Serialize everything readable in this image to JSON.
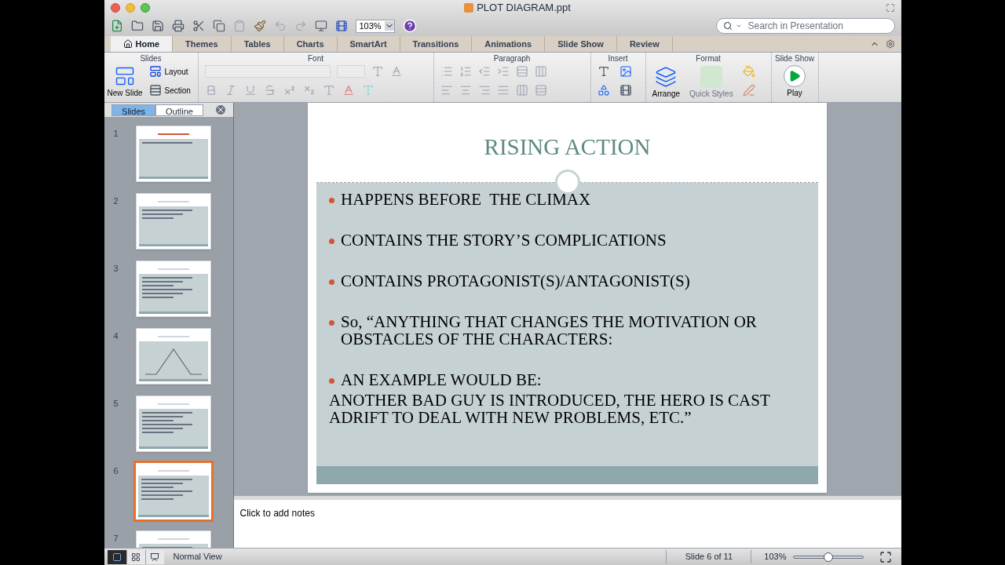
{
  "window": {
    "title": "PLOT DIAGRAM.ppt"
  },
  "toolbar": {
    "zoom": "103%"
  },
  "search": {
    "placeholder": "Search in Presentation"
  },
  "tabs": [
    {
      "label": "Home",
      "selected": true
    },
    {
      "label": "Themes",
      "selected": false
    },
    {
      "label": "Tables",
      "selected": false
    },
    {
      "label": "Charts",
      "selected": false
    },
    {
      "label": "SmartArt",
      "selected": false
    },
    {
      "label": "Transitions",
      "selected": false
    },
    {
      "label": "Animations",
      "selected": false
    },
    {
      "label": "Slide Show",
      "selected": false
    },
    {
      "label": "Review",
      "selected": false
    }
  ],
  "ribbon": {
    "slides_group": {
      "title": "Slides",
      "new_slide": "New Slide",
      "layout": "Layout",
      "section": "Section"
    },
    "font_group": {
      "title": "Font"
    },
    "paragraph_group": {
      "title": "Paragraph"
    },
    "insert_group": {
      "title": "Insert"
    },
    "format_group": {
      "title": "Format",
      "arrange": "Arrange",
      "quick_styles": "Quick Styles"
    },
    "slideshow_group": {
      "title": "Slide Show",
      "play": "Play"
    }
  },
  "pane_tabs": [
    {
      "label": "Slides",
      "selected": true
    },
    {
      "label": "Outline",
      "selected": false
    }
  ],
  "thumbnails": [
    {
      "number": "1",
      "selected": false,
      "kind": "title"
    },
    {
      "number": "2",
      "selected": false,
      "kind": "text"
    },
    {
      "number": "3",
      "selected": false,
      "kind": "list"
    },
    {
      "number": "4",
      "selected": false,
      "kind": "diagram"
    },
    {
      "number": "5",
      "selected": false,
      "kind": "list"
    },
    {
      "number": "6",
      "selected": true,
      "kind": "list"
    },
    {
      "number": "7",
      "selected": false,
      "kind": "text"
    }
  ],
  "slide": {
    "title": "RISING ACTION",
    "items": [
      {
        "kind": "bullet",
        "text": "HAPPENS BEFORE  THE CLIMAX"
      },
      {
        "kind": "bullet",
        "text": "CONTAINS THE STORY’S COMPLICATIONS"
      },
      {
        "kind": "bullet",
        "text": "CONTAINS PROTAGONIST(S)/ANTAGONIST(S)"
      },
      {
        "kind": "bullet",
        "text": "So, “ANYTHING THAT CHANGES THE MOTIVATION OR OBSTACLES OF THE CHARACTERS:"
      },
      {
        "kind": "bullet",
        "text": "AN EXAMPLE WOULD BE:"
      },
      {
        "kind": "plain",
        "text": "ANOTHER BAD GUY IS INTRODUCED, THE HERO IS CAST ADRIFT TO DEAL WITH NEW PROBLEMS, ETC.”"
      }
    ]
  },
  "notes": {
    "placeholder": "Click to add notes"
  },
  "status_bar": {
    "views": [
      {
        "kind": "normal",
        "selected": true
      },
      {
        "kind": "sorter",
        "selected": false
      },
      {
        "kind": "show",
        "selected": false
      }
    ],
    "view_name": "Normal View",
    "position": "Slide 6 of 11",
    "zoom": "103%",
    "zoom_slider": {
      "level": 0.5
    }
  }
}
